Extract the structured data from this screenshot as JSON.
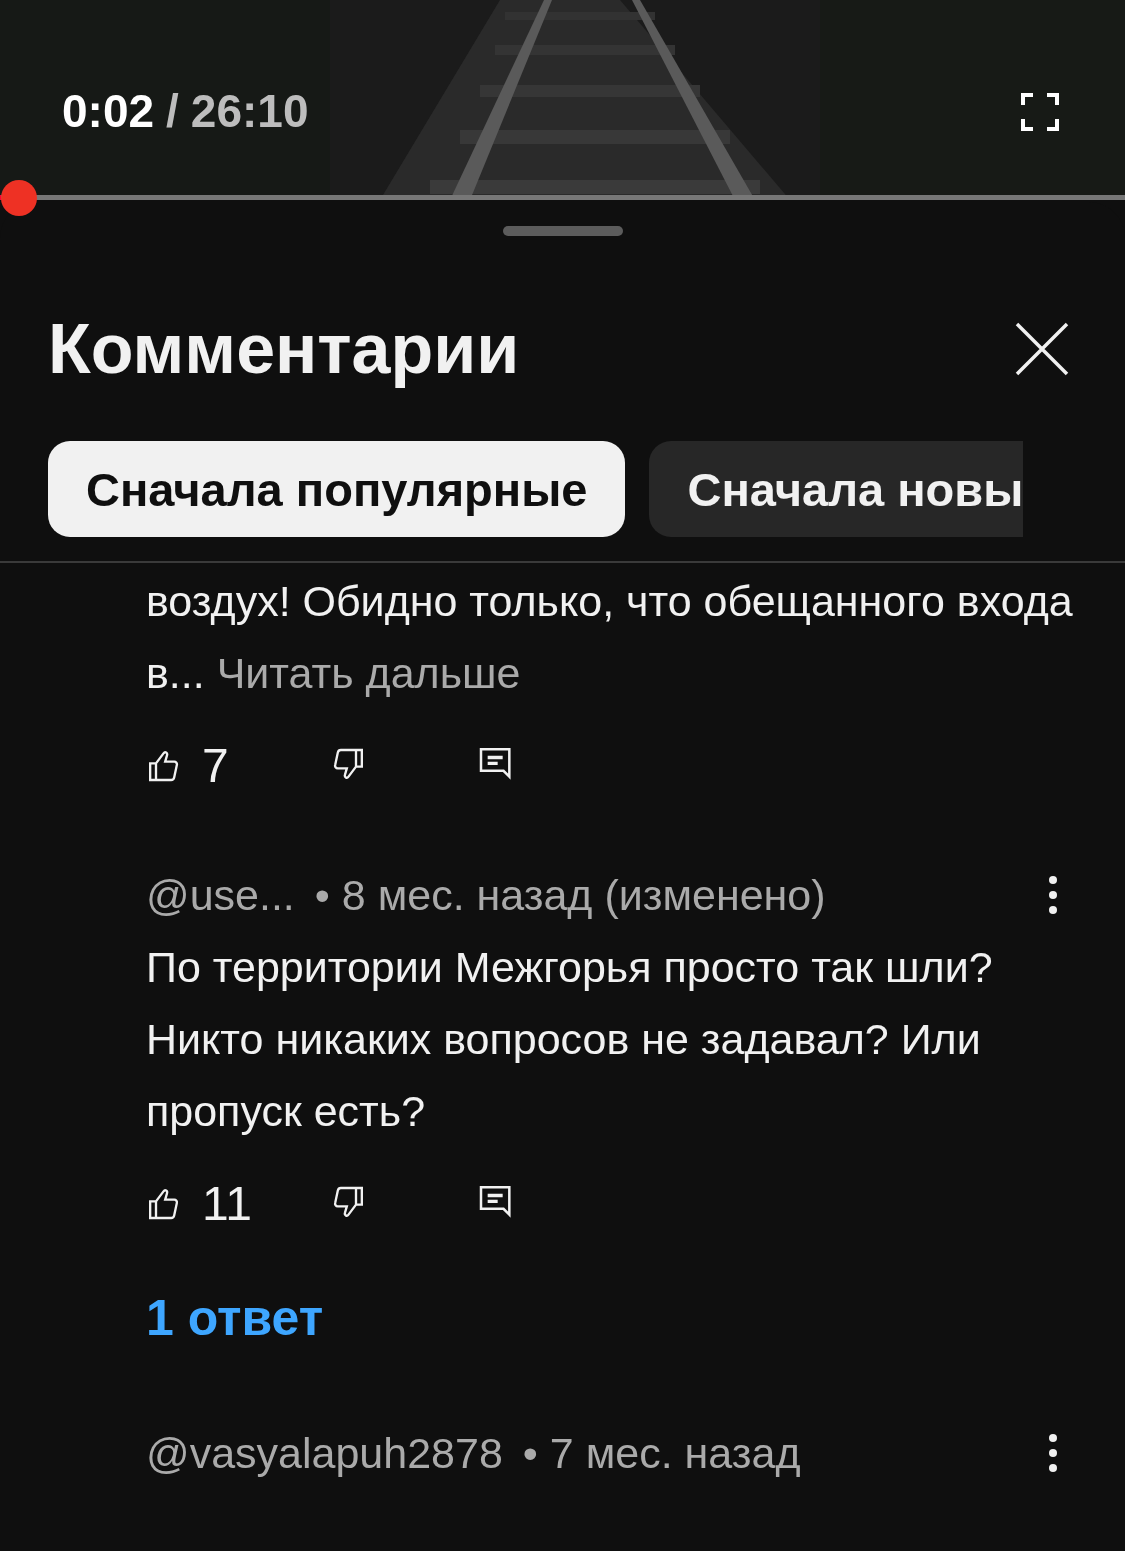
{
  "player": {
    "current_time": "0:02",
    "separator": "/",
    "duration": "26:10",
    "level": 0.001
  },
  "comments_panel": {
    "title": "Комментарии",
    "sort_chips": [
      {
        "label": "Сначала популярные",
        "selected": true
      },
      {
        "label": "Сначала новы",
        "selected": false
      }
    ],
    "comments": [
      {
        "text": "воздух! Обидно только, что обещанного входа в...",
        "read_more": "Читать дальше",
        "likes": "7"
      },
      {
        "author": "@use...",
        "meta": "• 8 мес. назад (изменено)",
        "text": "По территории Межгорья просто так шли? Никто никаких вопросов не задавал? Или пропуск есть?",
        "likes": "11",
        "replies": "1 ответ"
      },
      {
        "author": "@vasyalapuh2878",
        "meta": "• 7 мес. назад"
      }
    ]
  }
}
